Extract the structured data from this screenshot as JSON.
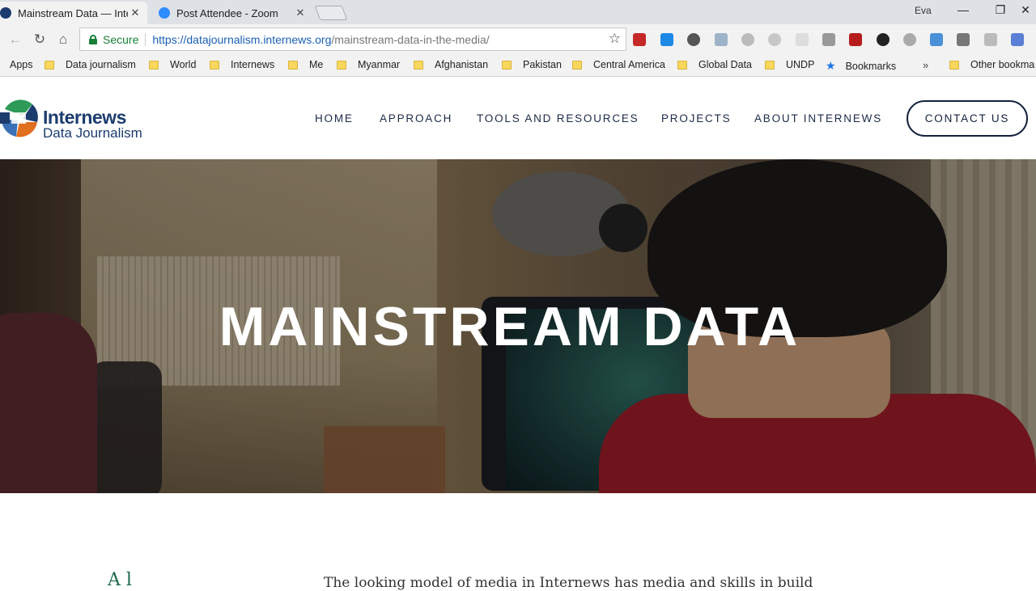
{
  "browser": {
    "tabs": [
      {
        "title": "Mainstream Data — Inte",
        "close": "✕"
      },
      {
        "title": "Post Attendee - Zoom",
        "close": "✕"
      }
    ],
    "profile_name": "Eva",
    "window_controls": {
      "minimize": "—",
      "maximize": "❐",
      "close": "✕"
    },
    "nav": {
      "back": "←",
      "forward": "→",
      "reload": "↻",
      "home": "⌂"
    },
    "security_label": "Secure",
    "url_host": "https://datajournalism.internews.org",
    "url_path": "/mainstream-data-in-the-media/",
    "bookmark_star": "☆"
  },
  "bookmarks": {
    "items": [
      {
        "label": "Apps",
        "icon": "apps-icon"
      },
      {
        "label": "Data journalism",
        "icon": "folder-icon"
      },
      {
        "label": "World",
        "icon": "folder-icon"
      },
      {
        "label": "Internews",
        "icon": "folder-icon"
      },
      {
        "label": "Me",
        "icon": "folder-icon"
      },
      {
        "label": "Myanmar",
        "icon": "folder-icon"
      },
      {
        "label": "Afghanistan",
        "icon": "folder-icon"
      },
      {
        "label": "Pakistan",
        "icon": "folder-icon"
      },
      {
        "label": "Central America",
        "icon": "folder-icon"
      },
      {
        "label": "Global Data",
        "icon": "folder-icon"
      },
      {
        "label": "UNDP",
        "icon": "folder-icon"
      },
      {
        "label": "Bookmarks",
        "icon": "star-icon"
      },
      {
        "label": "Other bookma",
        "icon": "folder-icon"
      }
    ],
    "overflow": "»"
  },
  "site": {
    "logo": {
      "title": "Internews",
      "subtitle": "Data Journalism"
    },
    "nav": [
      "HOME",
      "APPROACH",
      "TOOLS AND RESOURCES",
      "PROJECTS",
      "ABOUT INTERNEWS"
    ],
    "contact": "CONTACT US"
  },
  "hero": {
    "title": "MAINSTREAM DATA"
  },
  "content": {
    "left_fragment": "A          l",
    "right_fragment": "The looking            model of          media        in  Internews has    media and   skills           in  build"
  },
  "colors": {
    "brand_navy": "#1c3c6e",
    "nav_text": "#1c2b48",
    "secure_green": "#188038"
  }
}
